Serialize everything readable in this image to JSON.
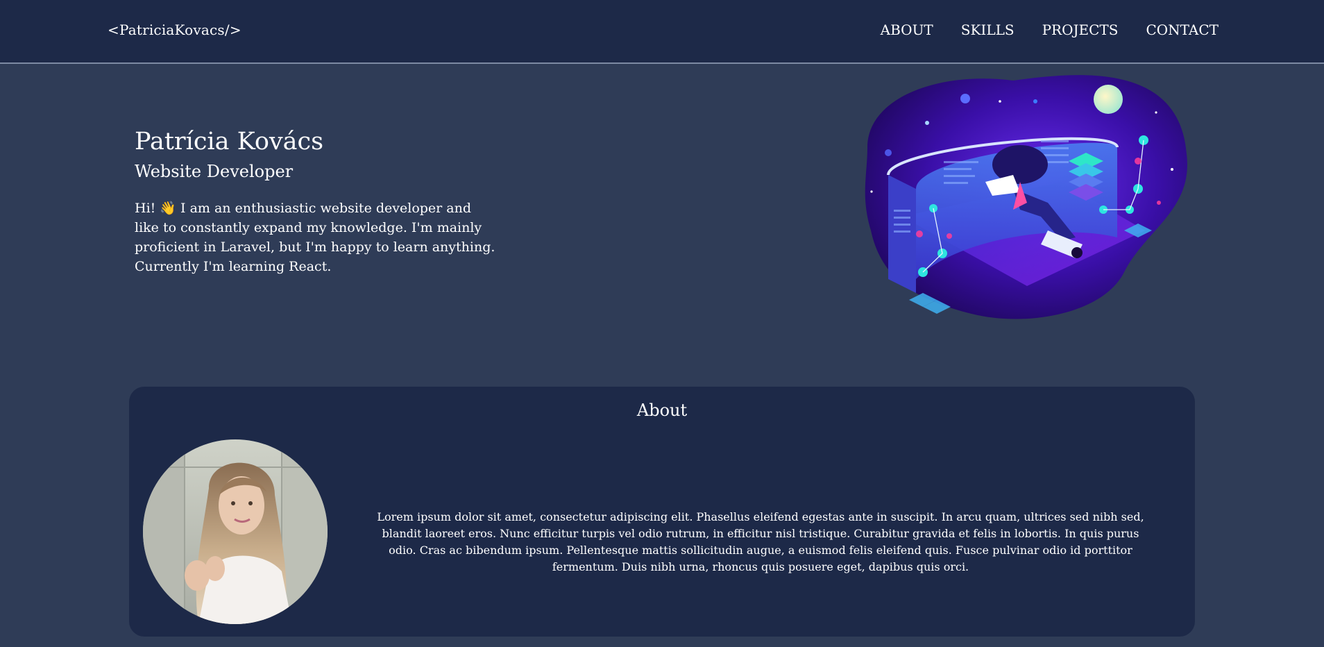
{
  "nav": {
    "brand": "<PatriciaKovacs/>",
    "links": [
      "ABOUT",
      "SKILLS",
      "PROJECTS",
      "CONTACT"
    ]
  },
  "hero": {
    "name": "Patrícia Kovács",
    "role": "Website Developer",
    "bio": "Hi! 👋 I am an enthusiastic website developer and like to constantly expand my knowledge. I'm mainly proficient in Laravel, but I'm happy to learn anything. Currently I'm learning React.",
    "illustration": "isometric-developer-illustration"
  },
  "about": {
    "title": "About",
    "avatar": "profile-photo",
    "text": "Lorem ipsum dolor sit amet, consectetur adipiscing elit. Phasellus eleifend egestas ante in suscipit. In arcu quam, ultrices sed nibh sed, blandit laoreet eros. Nunc efficitur turpis vel odio rutrum, in efficitur nisl tristique. Curabitur gravida et felis in lobortis. In quis purus odio. Cras ac bibendum ipsum. Pellentesque mattis sollicitudin augue, a euismod felis eleifend quis. Fusce pulvinar odio id porttitor fermentum. Duis nibh urna, rhoncus quis posuere eget, dapibus quis orci."
  },
  "colors": {
    "page_bg": "#2f3c57",
    "navbar_bg": "#1d2948",
    "card_bg": "#1d2948",
    "text": "#ffffff",
    "accent_purple": "#5b1fd1",
    "accent_cyan": "#2ee6e0"
  }
}
